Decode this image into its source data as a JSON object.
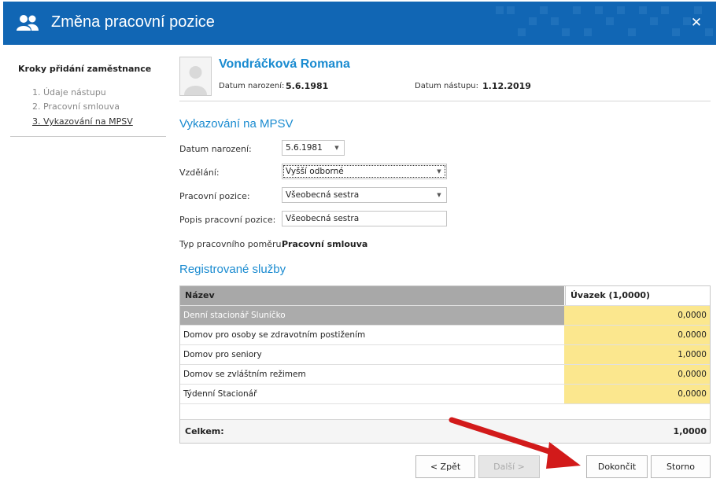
{
  "window": {
    "title": "Změna pracovní pozice",
    "close_glyph": "✕",
    "icon": "users-icon"
  },
  "steps": {
    "title": "Kroky přidání zaměstnance",
    "items": [
      "1. Údaje nástupu",
      "2. Pracovní smlouva",
      "3. Vykazování na MPSV"
    ],
    "active_index": 2
  },
  "employee": {
    "name": "Vondráčková Romana",
    "birth_label": "Datum narození:",
    "birth_value": "5.6.1981",
    "start_label": "Datum nástupu:",
    "start_value": "1.12.2019"
  },
  "mpsv": {
    "title": "Vykazování na MPSV",
    "birth_label": "Datum narození:",
    "birth_value": "5.6.1981",
    "education_label": "Vzdělání:",
    "education_value": "Vyšší odborné",
    "position_label": "Pracovní pozice:",
    "position_value": "Všeobecná sestra",
    "position_desc_label": "Popis pracovní pozice:",
    "position_desc_value": "Všeobecná sestra",
    "contract_type_label": "Typ pracovního poměru:",
    "contract_type_value": "Pracovní smlouva"
  },
  "services": {
    "title": "Registrované služby",
    "columns": [
      "Název",
      "Úvazek (1,0000)"
    ],
    "rows": [
      {
        "name": "Denní stacionář Sluníčko",
        "uvazek": "0,0000"
      },
      {
        "name": "Domov pro osoby se zdravotním postižením",
        "uvazek": "0,0000"
      },
      {
        "name": "Domov pro seniory",
        "uvazek": "1,0000"
      },
      {
        "name": "Domov se zvláštním režimem",
        "uvazek": "0,0000"
      },
      {
        "name": "Týdenní Stacionář",
        "uvazek": "0,0000"
      }
    ],
    "selected_row": 0,
    "total_label": "Celkem:",
    "total_value": "1,0000"
  },
  "buttons": {
    "back": "< Zpět",
    "next": "Další >",
    "finish": "Dokončit",
    "cancel": "Storno"
  },
  "colors": {
    "title_bar": "#1166b4",
    "accent": "#1a8bd0",
    "uvazek_cell": "#fbe78e",
    "annotation_arrow": "#d21a1a"
  }
}
